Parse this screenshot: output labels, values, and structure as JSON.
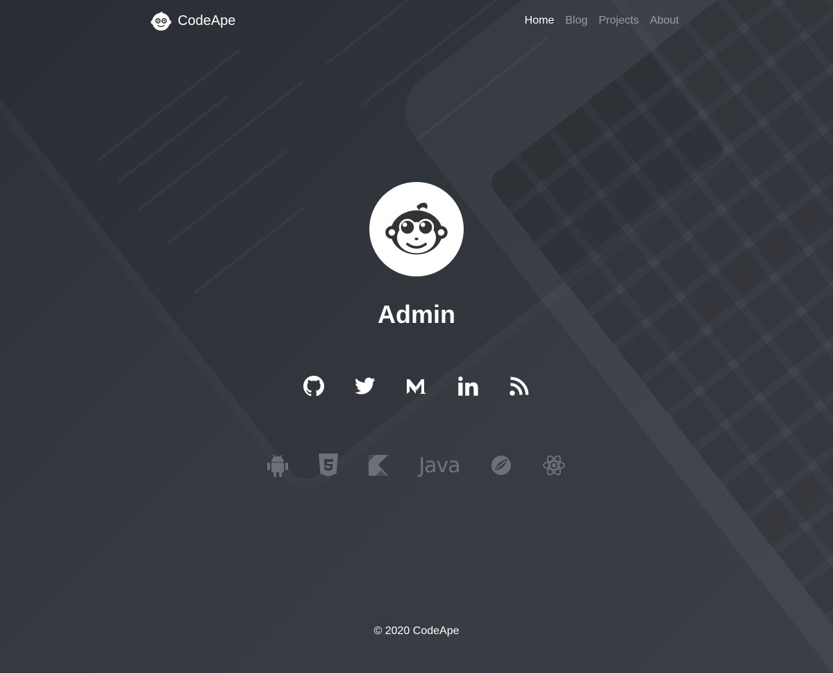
{
  "brand": {
    "name": "CodeApe"
  },
  "nav": {
    "items": [
      {
        "label": "Home",
        "active": true
      },
      {
        "label": "Blog",
        "active": false
      },
      {
        "label": "Projects",
        "active": false
      },
      {
        "label": "About",
        "active": false
      }
    ]
  },
  "profile": {
    "name": "Admin"
  },
  "social": [
    "github-icon",
    "twitter-icon",
    "medium-icon",
    "linkedin-icon",
    "rss-icon"
  ],
  "tech": {
    "icons": [
      "android-icon",
      "html5-icon",
      "kotlin-icon",
      "java-logo",
      "spring-icon",
      "react-icon"
    ],
    "java_label": "Java"
  },
  "footer": {
    "text": "© 2020 CodeApe"
  },
  "colors": {
    "background": "#33363d",
    "text": "#ffffff",
    "muted_link": "#9a9ea6",
    "tech_icon": "#6c7078"
  }
}
